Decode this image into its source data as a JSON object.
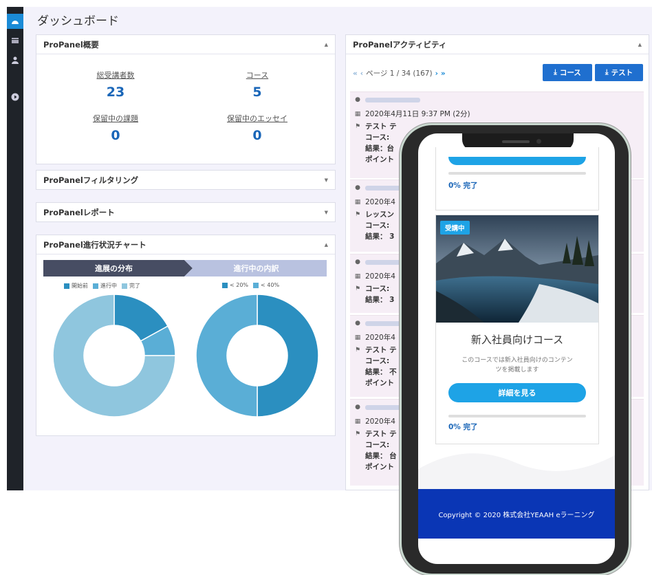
{
  "dashboard": {
    "title": "ダッシュボード"
  },
  "overview": {
    "title": "ProPanel概要",
    "stats": [
      {
        "label": "総受講者数",
        "value": "23"
      },
      {
        "label": "コース",
        "value": "5"
      },
      {
        "label": "保留中の課題",
        "value": "0"
      },
      {
        "label": "保留中のエッセイ",
        "value": "0"
      }
    ]
  },
  "filtering": {
    "title": "ProPanelフィルタリング"
  },
  "reports": {
    "title": "ProPanelレポート"
  },
  "progress_chart": {
    "title": "ProPanel進行状況チャート",
    "tab_left": "進展の分布",
    "tab_right": "進行中の内訳"
  },
  "activity": {
    "title": "ProPanelアクティビティ",
    "pager_text": "ページ 1 / 34 (167)",
    "course_button": "コース",
    "test_button": "テスト",
    "entries": [
      {
        "date": "2020年4月11日 9:37 PM (2分)",
        "type": "テスト テ",
        "course": "コース:",
        "result": "結果：台",
        "points": "ポイント"
      },
      {
        "date": "2020年4",
        "type": "レッスン",
        "course": "コース:",
        "result": "結果： 3"
      },
      {
        "date": "2020年4",
        "type": "コース:",
        "result": "結果： 3"
      },
      {
        "date": "2020年4",
        "type": "テスト テ",
        "course": "コース:",
        "result": "結果： 不",
        "points": "ポイント"
      },
      {
        "date": "2020年4",
        "type": "テスト テ",
        "course": "コース:",
        "result": "結果： 台",
        "points": "ポイント"
      }
    ]
  },
  "phone": {
    "top_progress": "0% 完了",
    "badge": "受講中",
    "course_title": "新入社員向けコース",
    "course_desc_1": "このコースでは新入社員向けのコンテン",
    "course_desc_2": "ツを掲載します",
    "cta": "詳細を見る",
    "progress": "0% 完了",
    "footer": "Copyright © 2020 株式会社YEAAH eラーニング"
  },
  "chart_data": [
    {
      "type": "pie",
      "title": "進展の分布",
      "categories": [
        "開始前",
        "進行中",
        "完了"
      ],
      "values": [
        17,
        8,
        75
      ],
      "colors": [
        "#2b8fc0",
        "#5aaed6",
        "#8fc6de"
      ]
    },
    {
      "type": "pie",
      "title": "進行中の内訳",
      "categories": [
        "< 20%",
        "< 40%"
      ],
      "values": [
        50,
        50
      ],
      "colors": [
        "#2b8fc0",
        "#5aaed6"
      ]
    }
  ]
}
